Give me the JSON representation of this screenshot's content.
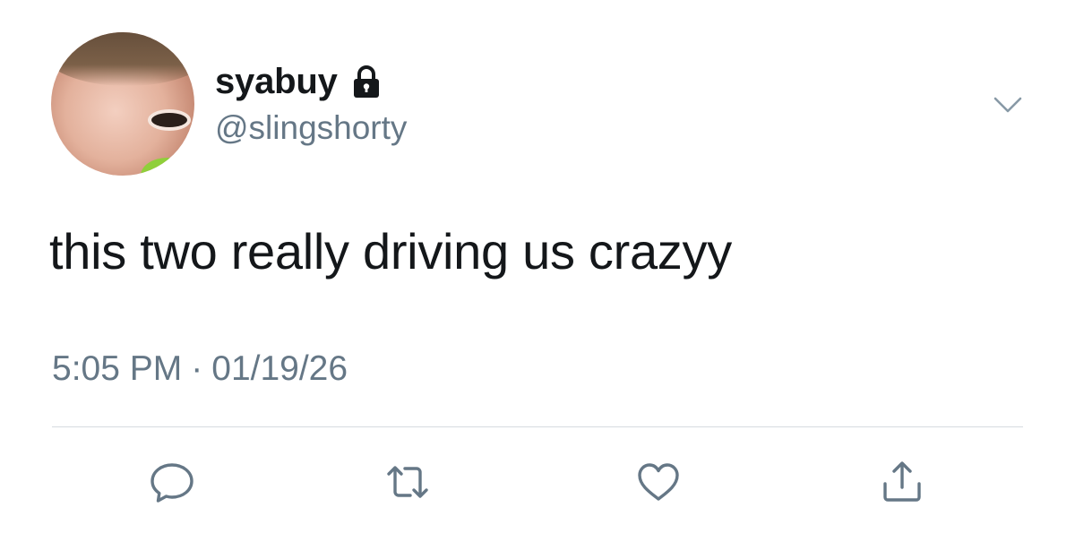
{
  "user": {
    "display_name": "syabuy",
    "handle": "@slingshorty",
    "locked": true
  },
  "tweet": {
    "text": "this two really driving us crazyy",
    "time": "5:05 PM",
    "separator": "·",
    "date": "01/19/26"
  },
  "icons": {
    "lock": "lock-icon",
    "menu": "chevron-down-icon",
    "reply": "reply-icon",
    "retweet": "retweet-icon",
    "like": "heart-icon",
    "share": "share-icon"
  },
  "colors": {
    "text": "#14171a",
    "secondary": "#657786",
    "icon": "#657786",
    "divider": "#d6dbe0",
    "background": "#ffffff"
  }
}
